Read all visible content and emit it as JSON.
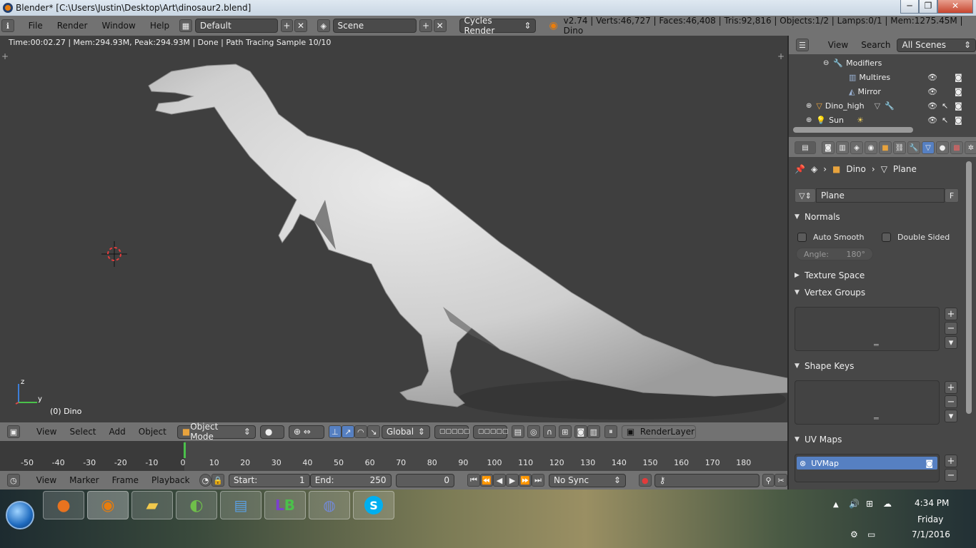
{
  "window": {
    "title": "Blender* [C:\\Users\\Justin\\Desktop\\Art\\dinosaur2.blend]",
    "min_label": "─",
    "max_label": "❐",
    "close_label": "✕"
  },
  "info_header": {
    "menus": [
      "File",
      "Render",
      "Window",
      "Help"
    ],
    "screen_layout": "Default",
    "scene": "Scene",
    "render_engine": "Cycles Render",
    "stats": "v2.74 | Verts:46,727 | Faces:46,408 | Tris:92,816 | Objects:1/2 | Lamps:0/1 | Mem:1275.45M | Dino"
  },
  "viewport": {
    "render_status": "Time:00:02.27 | Mem:294.93M, Peak:294.93M | Done | Path Tracing Sample 10/10",
    "object_label": "(0) Dino",
    "axis_z": "z",
    "axis_y": "y"
  },
  "viewport_header": {
    "menus": [
      "View",
      "Select",
      "Add",
      "Object"
    ],
    "mode": "Object Mode",
    "orientation": "Global",
    "render_layer": "RenderLayer"
  },
  "timeline": {
    "ticks": [
      "-50",
      "-40",
      "-30",
      "-20",
      "-10",
      "0",
      "10",
      "20",
      "30",
      "40",
      "50",
      "60",
      "70",
      "80",
      "90",
      "100",
      "110",
      "120",
      "130",
      "140",
      "150",
      "160",
      "170",
      "180"
    ],
    "current_frame": 0
  },
  "timeline_header": {
    "menus": [
      "View",
      "Marker",
      "Frame",
      "Playback"
    ],
    "start_label": "Start:",
    "start_value": "1",
    "end_label": "End:",
    "end_value": "250",
    "current": "0",
    "sync": "No Sync"
  },
  "outliner": {
    "menus": [
      "View",
      "Search"
    ],
    "filter": "All Scenes",
    "rows": [
      {
        "label": "Modifiers",
        "indent": 2
      },
      {
        "label": "Multires",
        "indent": 3
      },
      {
        "label": "Mirror",
        "indent": 3
      },
      {
        "label": "Dino_high",
        "indent": 1
      },
      {
        "label": "Sun",
        "indent": 1
      }
    ]
  },
  "properties": {
    "breadcrumb_object": "Dino",
    "breadcrumb_data": "Plane",
    "datablock_name": "Plane",
    "datablock_fake": "F",
    "normals": {
      "title": "Normals",
      "auto_smooth": "Auto Smooth",
      "double_sided": "Double Sided",
      "angle_label": "Angle:",
      "angle_value": "180°"
    },
    "texture_space": "Texture Space",
    "vertex_groups": "Vertex Groups",
    "shape_keys": "Shape Keys",
    "uv_maps": "UV Maps",
    "uv_map_item": "UVMap"
  },
  "taskbar": {
    "time": "4:34 PM",
    "day": "Friday",
    "date": "7/1/2016"
  },
  "colors": {
    "accent_blue": "#5680c2",
    "viewport_bg": "#3f3f3f",
    "header_gray": "#727272"
  }
}
